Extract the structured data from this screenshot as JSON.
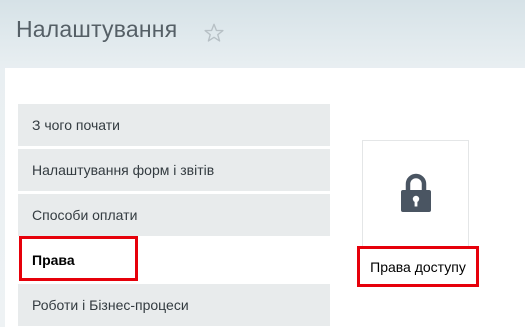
{
  "header": {
    "title": "Налаштування",
    "favorite_icon": "star-outline-icon"
  },
  "menu": {
    "items": [
      {
        "label": "З чого почати",
        "active": false
      },
      {
        "label": "Налаштування форм і звітів",
        "active": false
      },
      {
        "label": "Способи оплати",
        "active": false
      },
      {
        "label": "Права",
        "active": true
      },
      {
        "label": "Роботи і Бізнес-процеси",
        "active": false
      }
    ]
  },
  "tiles": [
    {
      "label": "Права доступу",
      "icon": "lock-icon"
    }
  ],
  "colors": {
    "highlight": "#e6000a",
    "lock": "#4a5562",
    "menu_bg": "#e8ebec"
  }
}
